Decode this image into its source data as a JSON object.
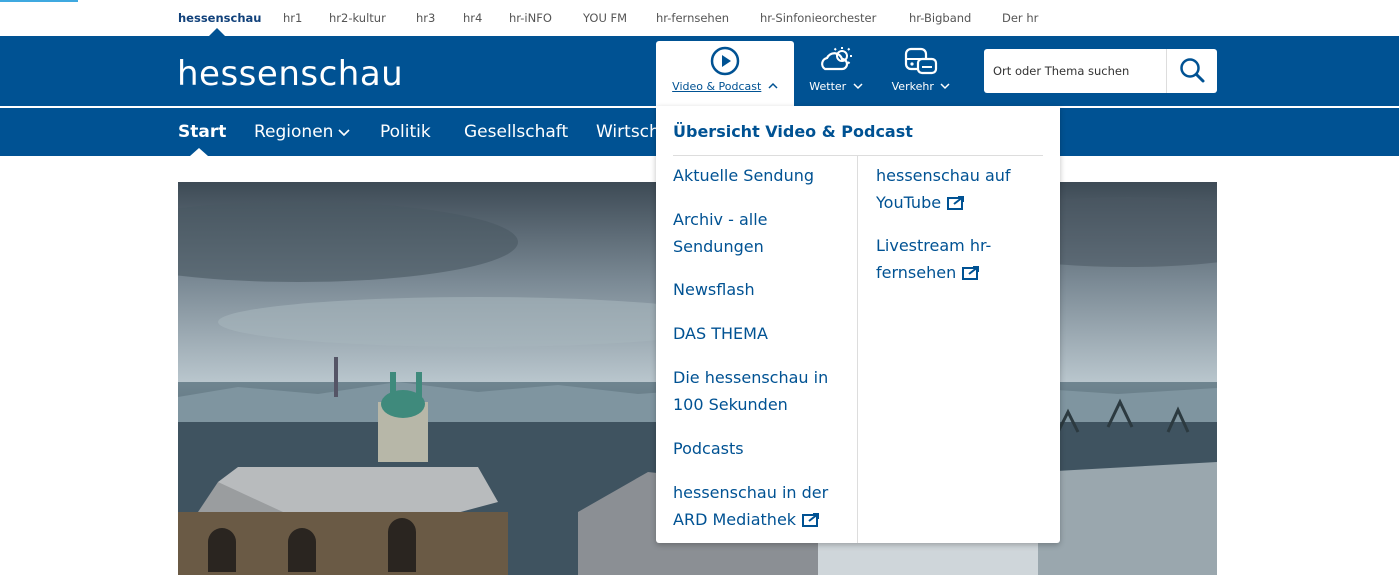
{
  "network_nav": {
    "items": [
      "hessenschau",
      "hr1",
      "hr2-kultur",
      "hr3",
      "hr4",
      "hr-iNFO",
      "YOU FM",
      "hr-fernsehen",
      "hr-Sinfonieorchester",
      "hr-Bigband",
      "Der hr"
    ]
  },
  "header": {
    "logo": "hessenschau",
    "video_label": "Video & Podcast",
    "weather_label": "Wetter",
    "traffic_label": "Verkehr",
    "search_placeholder": "Ort oder Thema suchen"
  },
  "main_nav": {
    "items": [
      "Start",
      "Regionen",
      "Politik",
      "Gesellschaft",
      "Wirtschaft"
    ]
  },
  "dropdown": {
    "title": "Übersicht Video & Podcast",
    "left_links": [
      "Aktuelle Sendung",
      "Archiv - alle Sendungen",
      "Newsflash",
      "DAS THEMA",
      "Die hessenschau in 100 Sekunden",
      "Podcasts",
      "hessenschau in der ARD Mediathek"
    ],
    "right_links": [
      "hessenschau auf YouTube",
      "Livestream hr-fernsehen"
    ]
  },
  "colors": {
    "brand_blue": "#005293",
    "accent_light_blue": "#3fa9e0"
  },
  "icons": [
    "play-circle-icon",
    "weather-cloud-sun-icon",
    "traffic-car-icon",
    "search-icon",
    "chevron-down-icon",
    "chevron-up-icon",
    "external-link-icon"
  ]
}
